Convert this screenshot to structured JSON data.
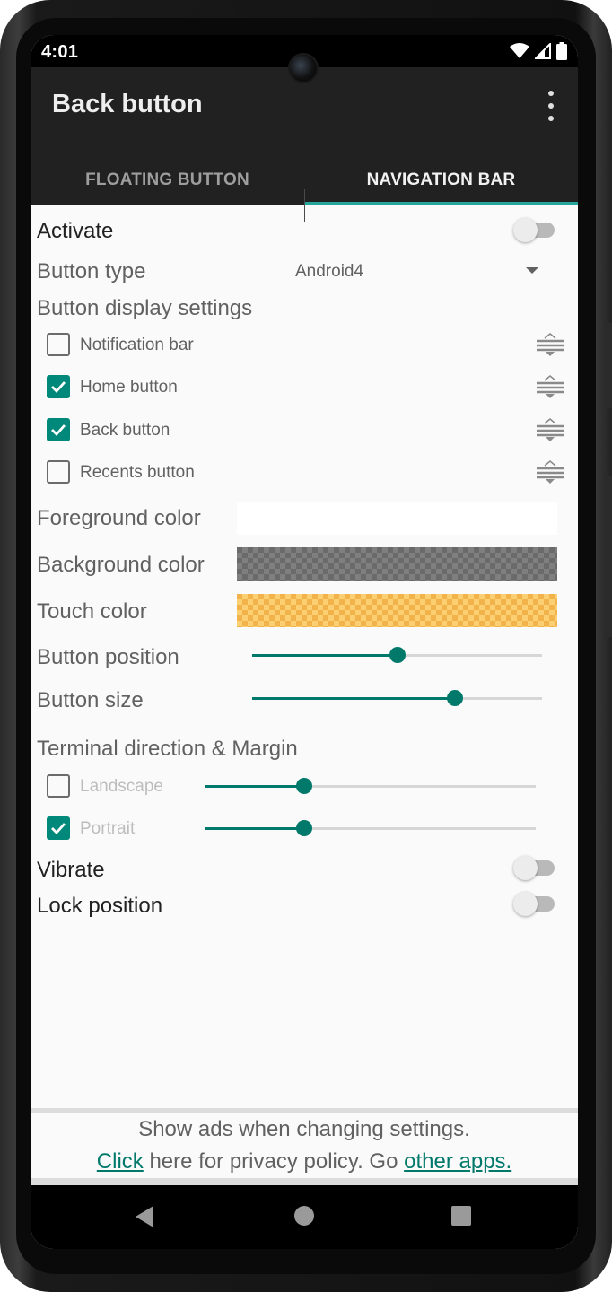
{
  "status_bar": {
    "time": "4:01",
    "icons": [
      "wifi-icon",
      "signal-icon",
      "battery-icon"
    ]
  },
  "app_bar": {
    "title": "Back button",
    "overflow_icon": "more-vert-icon"
  },
  "tabs": [
    {
      "label": "FLOATING BUTTON",
      "active": false
    },
    {
      "label": "NAVIGATION BAR",
      "active": true
    }
  ],
  "settings": {
    "activate": {
      "label": "Activate",
      "on": false
    },
    "button_type": {
      "label": "Button type",
      "value": "Android4"
    },
    "display_settings": {
      "heading": "Button display settings",
      "items": [
        {
          "label": "Notification bar",
          "checked": false
        },
        {
          "label": "Home button",
          "checked": true
        },
        {
          "label": "Back button",
          "checked": true
        },
        {
          "label": "Recents button",
          "checked": false
        }
      ]
    },
    "foreground_color": {
      "label": "Foreground color",
      "color": "#ffffff"
    },
    "background_color": {
      "label": "Background color",
      "color": "#6a6a6a",
      "transparent": true
    },
    "touch_color": {
      "label": "Touch color",
      "color": "#f2b44a",
      "transparent": true
    },
    "button_position": {
      "label": "Button position",
      "value_percent": 50
    },
    "button_size": {
      "label": "Button size",
      "value_percent": 70
    },
    "terminal_direction": {
      "heading": "Terminal direction & Margin",
      "items": [
        {
          "label": "Landscape",
          "checked": false,
          "value_percent": 30
        },
        {
          "label": "Portrait",
          "checked": true,
          "value_percent": 30
        }
      ]
    },
    "vibrate": {
      "label": "Vibrate",
      "on": false
    },
    "lock_position": {
      "label": "Lock position",
      "on": false
    }
  },
  "footer": {
    "line1": "Show ads when changing settings.",
    "link_click": "Click",
    "middle_text": " here for privacy policy. Go ",
    "link_other_apps": "other apps."
  },
  "nav_bar": {
    "buttons": [
      "back-icon",
      "home-icon",
      "recents-icon"
    ]
  },
  "colors": {
    "accent": "#00796b",
    "app_bar": "#212121",
    "tab_indicator": "#26a69a"
  }
}
